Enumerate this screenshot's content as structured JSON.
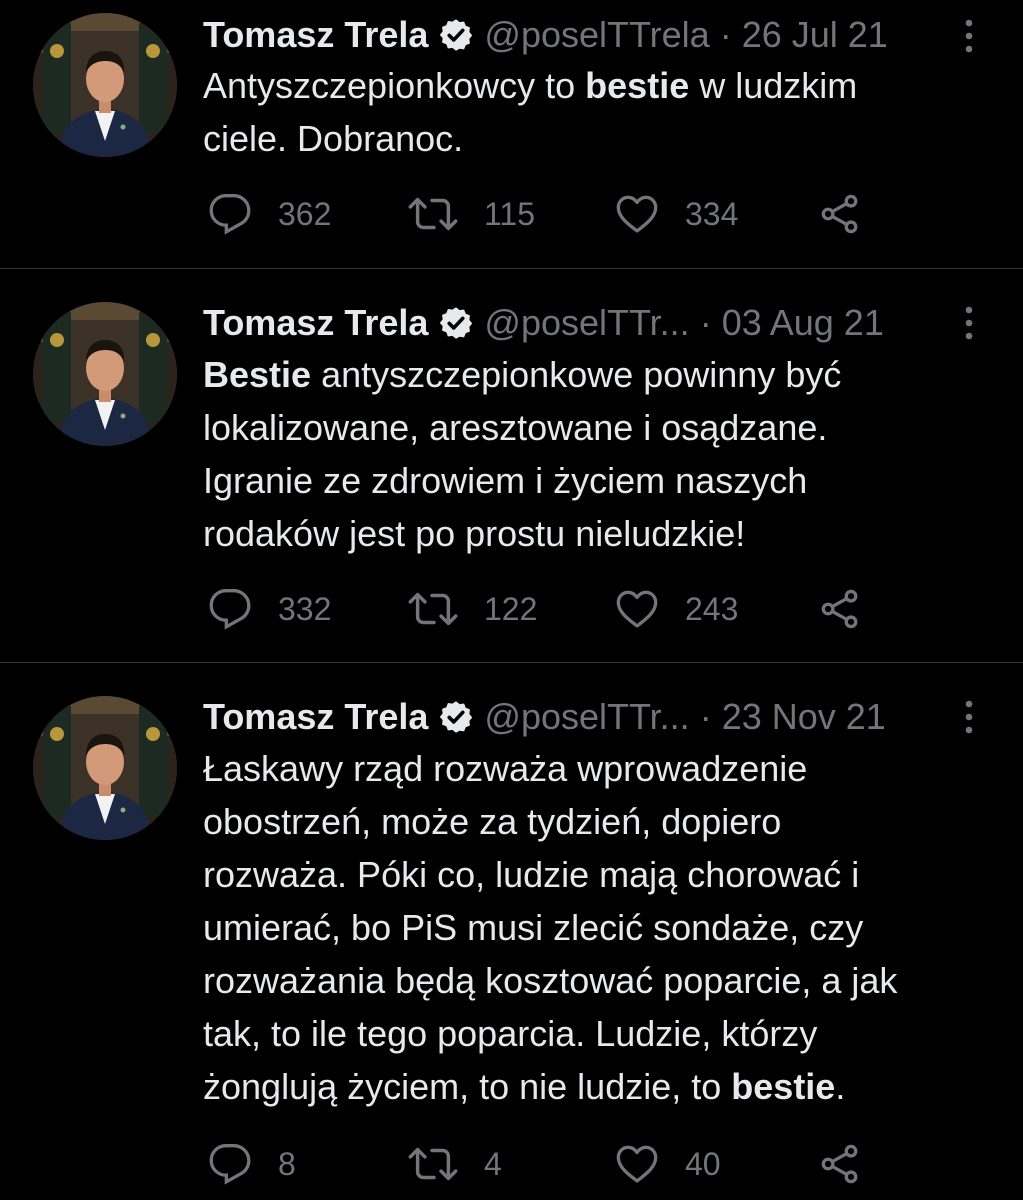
{
  "colors": {
    "background": "#000000",
    "text": "#e7e9ea",
    "muted": "#71767b",
    "divider": "#2f3336"
  },
  "tweets": [
    {
      "author": "Tomasz Trela",
      "handle": "@poselTTrela",
      "date": "26 Jul 21",
      "verified": true,
      "body": [
        {
          "text": "Antyszczepionkowcy to ",
          "bold": false
        },
        {
          "text": "bestie",
          "bold": true
        },
        {
          "text": " w ludzkim\nciele. Dobranoc.",
          "bold": false
        }
      ],
      "replies": "362",
      "retweets": "115",
      "likes": "334"
    },
    {
      "author": "Tomasz Trela",
      "handle": "@poselTTr...",
      "date": "03 Aug 21",
      "verified": true,
      "body": [
        {
          "text": "Bestie",
          "bold": true
        },
        {
          "text": " antyszczepionkowe powinny być\nlokalizowane, aresztowane i osądzane.\nIgranie ze zdrowiem i życiem naszych\nrodaków jest po prostu nieludzkie!",
          "bold": false
        }
      ],
      "replies": "332",
      "retweets": "122",
      "likes": "243"
    },
    {
      "author": "Tomasz Trela",
      "handle": "@poselTTr...",
      "date": "23 Nov 21",
      "verified": true,
      "body": [
        {
          "text": "Łaskawy rząd rozważa wprowadzenie\nobostrzeń, może za tydzień, dopiero\nrozważa. Póki co, ludzie mają chorować i\numierać, bo PiS musi zlecić sondaże, czy\nrozważania będą kosztować poparcie, a jak\ntak, to ile tego poparcia. Ludzie, którzy\nżonglują życiem, to nie ludzie, to ",
          "bold": false
        },
        {
          "text": "bestie",
          "bold": true
        },
        {
          "text": ".",
          "bold": false
        }
      ],
      "replies": "8",
      "retweets": "4",
      "likes": "40"
    }
  ]
}
